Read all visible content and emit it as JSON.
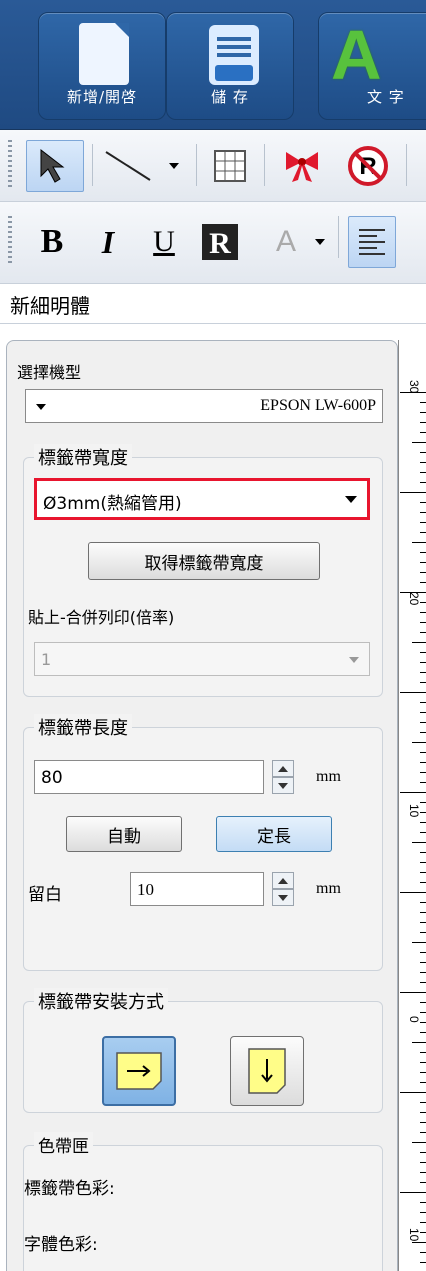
{
  "ribbon": {
    "new_open": "新增/開啓",
    "save": "儲 存",
    "text": "文 字"
  },
  "font": {
    "name": "新細明體"
  },
  "panel": {
    "model_label": "選擇機型",
    "model_value": "EPSON LW-600P",
    "tape_width": {
      "title": "標籤帶寬度",
      "value": "Ø3mm(熱縮管用)",
      "get_button": "取得標籤帶寬度",
      "paste_label": "貼上-合併列印(倍率)",
      "paste_value": "1"
    },
    "tape_length": {
      "title": "標籤帶長度",
      "value": "80",
      "unit": "mm",
      "auto_button": "自動",
      "fixed_button": "定長",
      "margin_label": "留白",
      "margin_value": "10",
      "margin_unit": "mm"
    },
    "install": {
      "title": "標籤帶安裝方式"
    },
    "ribbon_box": {
      "title": "色帶匣",
      "tape_color": "標籤帶色彩:",
      "font_color": "字體色彩:"
    }
  },
  "ruler": {
    "labels": [
      "30",
      "20",
      "10",
      "0",
      "10"
    ]
  },
  "colors": {
    "ribbon": "#1f4a82",
    "highlight": "#e8152e",
    "selected": "#bcd5f3"
  }
}
